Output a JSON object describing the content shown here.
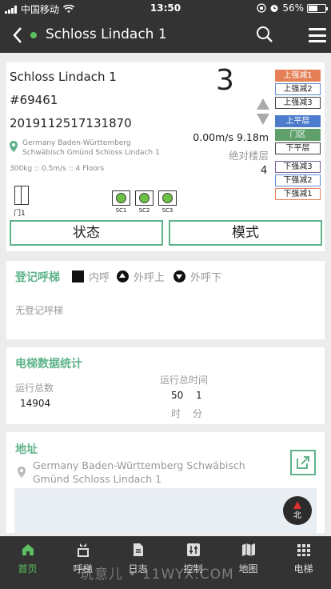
{
  "status_bar": {
    "carrier": "中国移动",
    "time": "13:50",
    "battery": "56%",
    "battery_level": 0.56
  },
  "header": {
    "title": "Schloss Lindach 1"
  },
  "elevator": {
    "name": "Schloss Lindach 1",
    "id": "#69461",
    "serial": "2019112517131870",
    "location": [
      "Germany Baden-Württemberg",
      "Schwäbisch Gmünd Schloss Lindach 1"
    ],
    "spec": "300kg :: 0.5m/s :: 4 Floors",
    "current_floor": "3",
    "speed_height": "0.00m/s 9.18m",
    "abs_floor_label": "绝对楼层",
    "abs_floor_value": "4",
    "door_label": "门1",
    "safety_circuits": [
      "SC1",
      "SC2",
      "SC3"
    ],
    "modes_top": [
      "上强减1",
      "上强减2",
      "上强减3"
    ],
    "modes_mid": [
      "上平层",
      "门区",
      "下平层"
    ],
    "modes_bottom": [
      "下强减3",
      "下强减2",
      "下强减1"
    ],
    "status_button": "状态",
    "mode_button": "模式"
  },
  "call_register": {
    "title": "登记呼梯",
    "legend": [
      "内呼",
      "外呼上",
      "外呼下"
    ],
    "empty_text": "无登记呼梯"
  },
  "stats": {
    "title": "电梯数据统计",
    "run_count_label": "运行总数",
    "run_count": "14904",
    "run_time_label": "运行总时间",
    "run_time_hours": "50",
    "run_time_minutes": "1",
    "hour_unit": "时",
    "minute_unit": "分"
  },
  "address": {
    "title": "地址",
    "text": "Germany Baden-Württemberg Schwäbisch Gmünd Schloss Lindach 1",
    "compass_label": "北"
  },
  "tabs": [
    "首页",
    "呼梯",
    "日志",
    "控制",
    "地图",
    "电梯"
  ],
  "watermark": "玩意儿 • 11WYX.COM",
  "colors": {
    "accent": "#5fb38a",
    "header": "#333333",
    "active_tab": "#5cc060"
  }
}
